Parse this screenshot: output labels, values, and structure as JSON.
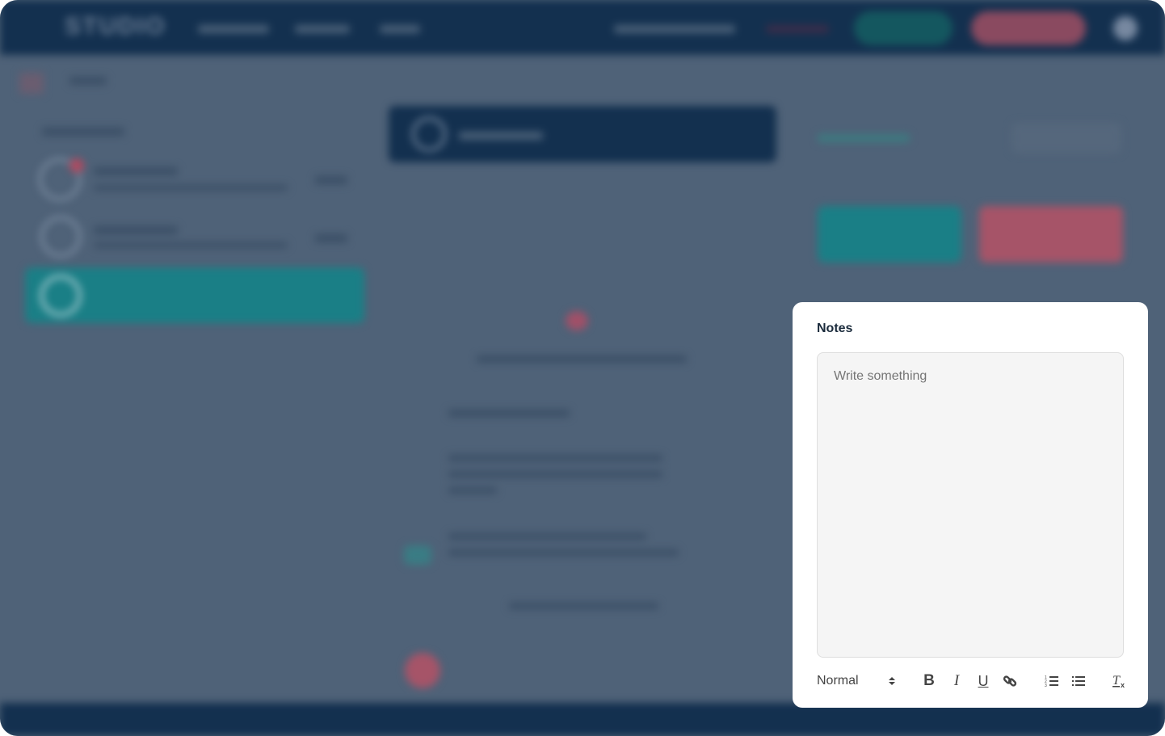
{
  "background": {
    "logo": "STUDIO",
    "blurred": true
  },
  "colors": {
    "header": "#13304f",
    "overlay": "#4f6278",
    "teal": "#1a7f86",
    "pink": "#a65468",
    "modal": "#ffffff"
  },
  "notes": {
    "title": "Notes",
    "placeholder": "Write something",
    "value": "",
    "toolbar": {
      "format_select": "Normal",
      "buttons": [
        "bold",
        "italic",
        "underline",
        "link",
        "ordered-list",
        "bullet-list",
        "clear-formatting"
      ]
    }
  }
}
